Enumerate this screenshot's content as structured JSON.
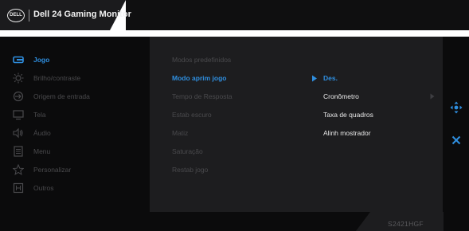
{
  "header": {
    "logo_text": "DELL",
    "title": "Dell 24 Gaming Monitor"
  },
  "main_menu": {
    "items": [
      {
        "label": "Jogo",
        "icon": "game-icon",
        "state": "active"
      },
      {
        "label": "Brilho/contraste",
        "icon": "brightness-icon",
        "state": "dim"
      },
      {
        "label": "Origem de entrada",
        "icon": "input-source-icon",
        "state": "dim"
      },
      {
        "label": "Tela",
        "icon": "display-icon",
        "state": "dim"
      },
      {
        "label": "Áudio",
        "icon": "audio-icon",
        "state": "dim"
      },
      {
        "label": "Menu",
        "icon": "menu-icon",
        "state": "dim"
      },
      {
        "label": "Personalizar",
        "icon": "star-icon",
        "state": "dim"
      },
      {
        "label": "Outros",
        "icon": "others-icon",
        "state": "dim"
      }
    ]
  },
  "submenu": {
    "items": [
      {
        "label": "Modos predefinidos",
        "state": "dim"
      },
      {
        "label": "Modo aprim jogo",
        "state": "active"
      },
      {
        "label": "Tempo de Resposta",
        "state": "dim"
      },
      {
        "label": "Estab escuro",
        "state": "dim"
      },
      {
        "label": "Matiz",
        "state": "dim"
      },
      {
        "label": "Saturação",
        "state": "dim"
      },
      {
        "label": "Restab jogo",
        "state": "dim"
      }
    ]
  },
  "options": {
    "items": [
      {
        "label": "Des.",
        "state": "selected"
      },
      {
        "label": "Cronômetro",
        "state": "normal"
      },
      {
        "label": "Taxa de quadros",
        "state": "normal"
      },
      {
        "label": "Alinh mostrador",
        "state": "normal"
      }
    ]
  },
  "right_controls": {
    "nav_icon": "navigate-icon",
    "close_icon": "close-icon"
  },
  "footer": {
    "model": "S2421HGF"
  },
  "colors": {
    "accent": "#2f8fe0",
    "dim_text": "#4a4a4d",
    "panel": "#1d1d1f",
    "background": "#0b0b0c"
  }
}
